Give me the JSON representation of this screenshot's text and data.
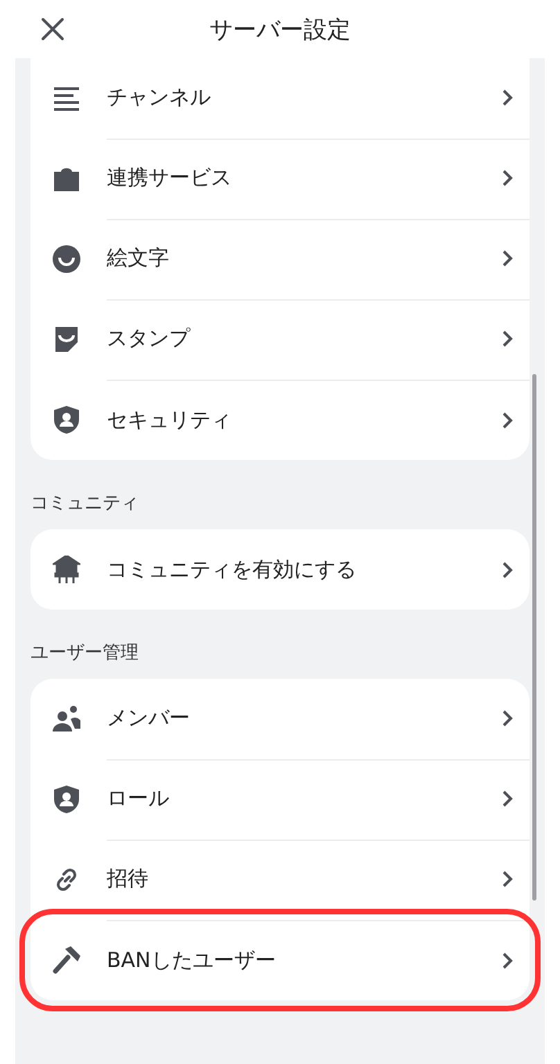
{
  "header": {
    "title": "サーバー設定"
  },
  "sections": [
    {
      "items": [
        {
          "label": "チャンネル",
          "highlighted": false
        },
        {
          "label": "連携サービス",
          "highlighted": false
        },
        {
          "label": "絵文字",
          "highlighted": false
        },
        {
          "label": "スタンプ",
          "highlighted": false
        },
        {
          "label": "セキュリティ",
          "highlighted": false
        }
      ]
    },
    {
      "title": "コミュニティ",
      "items": [
        {
          "label": "コミュニティを有効にする",
          "highlighted": false
        }
      ]
    },
    {
      "title": "ユーザー管理",
      "items": [
        {
          "label": "メンバー",
          "highlighted": false
        },
        {
          "label": "ロール",
          "highlighted": false
        },
        {
          "label": "招待",
          "highlighted": false
        },
        {
          "label": "BANしたユーザー",
          "highlighted": true
        }
      ]
    }
  ]
}
